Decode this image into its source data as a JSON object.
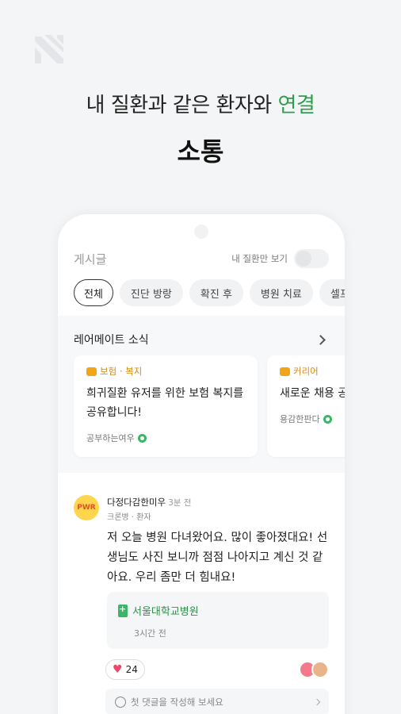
{
  "hero": {
    "headline_main": "내 질환과 같은 환자와 ",
    "headline_accent": "연결",
    "subhead": "소통"
  },
  "board": {
    "title": "게시글",
    "toggle_label": "내 질환만 보기",
    "chips": [
      "전체",
      "진단 방랑",
      "확진 후",
      "병원 치료",
      "셀프"
    ]
  },
  "news": {
    "title": "레어메이트 소식",
    "cards": [
      {
        "tag": "보험 · 복지",
        "title": "희귀질환 유저를 위한 보험 복지를 공유합니다!",
        "author": "공부하는여우"
      },
      {
        "tag": "커리어",
        "title": "새로운 채용 공고가 올라왔어요!",
        "author": "용감한판다"
      }
    ]
  },
  "post": {
    "avatar_text": "PWR",
    "author": "다정다감한미우",
    "time": "3분 전",
    "subtitle": "크론병 · 환자",
    "body": "저 오늘 병원 다녀왔어요. 많이 좋아졌대요! 선생님도 사진 보니까 점점 나아지고 계신 것 같아요. 우리 좀만 더 힘내요!",
    "hospital": "서울대학교병원",
    "hospital_time": "3시간 전",
    "likes": "24",
    "comment_placeholder": "첫 댓글을 작성해 보세요"
  },
  "colors": {
    "accent_green": "#2e9e4e",
    "tag_orange": "#d58a12",
    "like_red": "#e84a6a"
  }
}
